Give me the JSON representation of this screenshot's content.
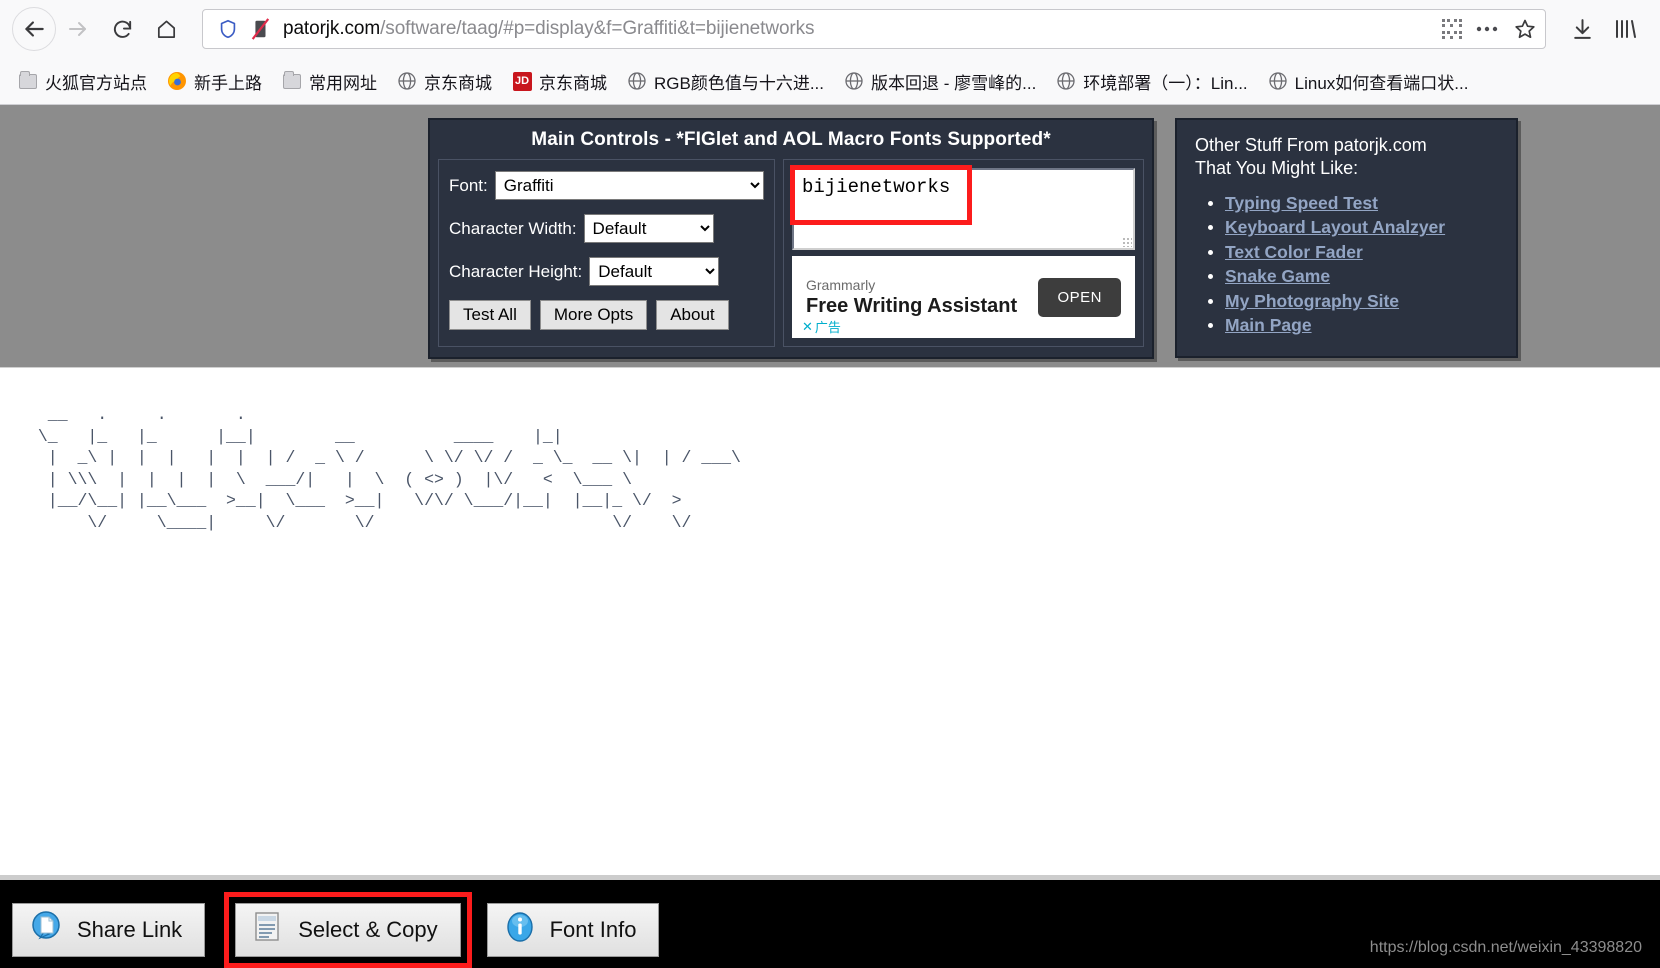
{
  "browser": {
    "nav": {
      "back_icon": "arrow-left-icon",
      "forward_icon": "arrow-right-icon",
      "reload_icon": "reload-icon",
      "home_icon": "home-icon",
      "downloads_icon": "download-icon",
      "library_icon": "library-icon"
    },
    "url": {
      "host": "patorjk.com",
      "path": "/software/taag/#p=display&f=Graffiti&t=bijienetworks",
      "full": "patorjk.com/software/taag/#p=display&f=Graffiti&t=bijienetworks",
      "shield_icon": "shield-icon",
      "reader_icon": "reader-mode-icon",
      "qr_icon": "qr-code-icon",
      "more_icon": "ellipsis-icon",
      "bookmark_icon": "star-icon"
    },
    "bookmarks": [
      {
        "label": "火狐官方站点",
        "icon": "folder-icon"
      },
      {
        "label": "新手上路",
        "icon": "firefox-icon"
      },
      {
        "label": "常用网址",
        "icon": "folder-icon"
      },
      {
        "label": "京东商城",
        "icon": "globe-icon"
      },
      {
        "label": "京东商城",
        "icon": "jd-icon"
      },
      {
        "label": "RGB颜色值与十六进...",
        "icon": "globe-icon"
      },
      {
        "label": "版本回退 - 廖雪峰的...",
        "icon": "globe-icon"
      },
      {
        "label": "环境部署（一）：Lin...",
        "icon": "globe-icon"
      },
      {
        "label": "Linux如何查看端口状...",
        "icon": "globe-icon"
      }
    ]
  },
  "main_controls": {
    "title": "Main Controls - *FIGlet and AOL Macro Fonts Supported*",
    "font": {
      "label": "Font:",
      "value": "Graffiti"
    },
    "char_width": {
      "label": "Character Width:",
      "value": "Default"
    },
    "char_height": {
      "label": "Character Height:",
      "value": "Default"
    },
    "buttons": [
      {
        "label": "Test All"
      },
      {
        "label": "More Opts"
      },
      {
        "label": "About"
      }
    ],
    "text_input": {
      "value": "bijienetworks",
      "placeholder": ""
    },
    "highlight_color": "#fc1c1c",
    "ad": {
      "brand": "Grammarly",
      "headline": "Free Writing Assistant",
      "open_label": "OPEN",
      "close_label": "广告",
      "close_icon": "close-icon"
    }
  },
  "other_stuff": {
    "title_line1": "Other Stuff From patorjk.com",
    "title_line2": "That You Might Like:",
    "links": [
      "Typing Speed Test",
      "Keyboard Layout Analzyer",
      "Text Color Fader",
      "Snake Game",
      "My Photography Site",
      "Main Page"
    ]
  },
  "ascii_art": {
    "text": "bijienetworks",
    "font": "Graffiti",
    "lines": [
      "  __   .     .       .",
      " \\_   |_   |_      |__|        __          ____    |_|        ",
      "  |  _\\ |  |  |   |  |  | /  _ \\ /      \\ \\/ \\/ /  _ \\_  __ \\|  | / ___\\ ",
      "  | \\\\\\  |  |  |  |  \\  ___/|   |  \\  ( <> )  |\\/   <  \\___ \\ ",
      "  |__/\\__| |__\\___  >__|  \\___  >__|   \\/\\/ \\___/|__|  |__|_ \\/  > ",
      "      \\/     \\____|     \\/       \\/                        \\/    \\/  "
    ]
  },
  "bottom_bar": {
    "buttons": [
      {
        "label": "Share Link",
        "icon": "share-link-icon",
        "highlighted": false
      },
      {
        "label": "Select & Copy",
        "icon": "document-copy-icon",
        "highlighted": true
      },
      {
        "label": "Font Info",
        "icon": "info-icon",
        "highlighted": false
      }
    ],
    "watermark": "https://blog.csdn.net/weixin_43398820"
  }
}
